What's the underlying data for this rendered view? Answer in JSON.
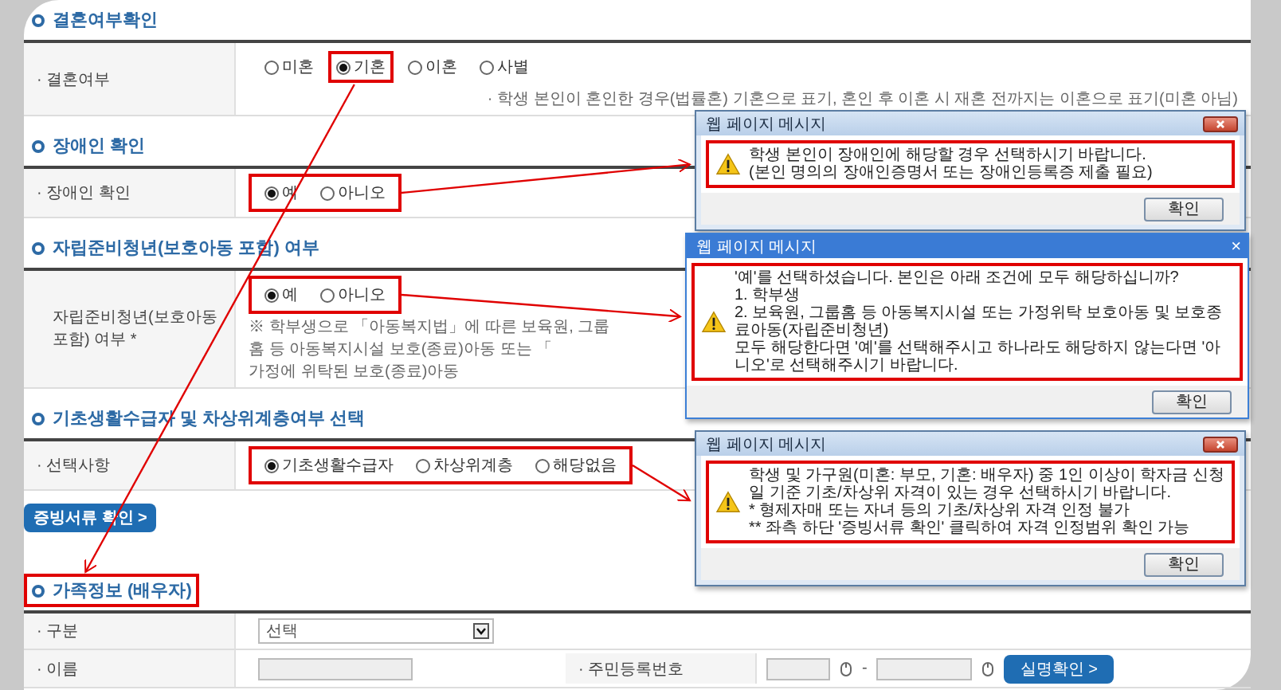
{
  "sections": [
    {
      "title": "결혼여부확인",
      "title_highlighted": false,
      "rows": [
        {
          "kind": "radio",
          "label": "· 결혼여부",
          "highlighted": false,
          "options": [
            {
              "label": "미혼",
              "selected": false,
              "highlighted": false
            },
            {
              "label": "기혼",
              "selected": true,
              "highlighted": true
            },
            {
              "label": "이혼",
              "selected": false,
              "highlighted": false
            },
            {
              "label": "사별",
              "selected": false,
              "highlighted": false
            }
          ],
          "note": "· 학생 본인이 혼인한 경우(법률혼) 기혼으로 표기, 혼인 후 이혼 시 재혼 전까지는 이혼으로 표기(미혼 아님)"
        }
      ]
    },
    {
      "title": "장애인 확인",
      "title_highlighted": false,
      "rows": [
        {
          "kind": "radio",
          "label": "· 장애인 확인",
          "highlighted": true,
          "options": [
            {
              "label": "예",
              "selected": true,
              "highlighted": false
            },
            {
              "label": "아니오",
              "selected": false,
              "highlighted": false
            }
          ],
          "dialog": {
            "kind": "classic",
            "title": "웹 페이지 메시지",
            "message_highlighted": true,
            "lines": [
              "학생 본인이 장애인에 해당할 경우 선택하시기 바랍니다.",
              "(본인 명의의 장애인증명서 또는 장애인등록증 제출 필요)"
            ],
            "button": "확인"
          }
        }
      ]
    },
    {
      "title": "자립준비청년(보호아동 포함) 여부",
      "title_highlighted": false,
      "rows": [
        {
          "kind": "radio",
          "label": "자립준비청년(보호아동 포함) 여부 *",
          "highlighted": true,
          "options": [
            {
              "label": "예",
              "selected": true,
              "highlighted": false
            },
            {
              "label": "아니오",
              "selected": false,
              "highlighted": false
            }
          ],
          "note": "※ 학부생으로 「아동복지법」에 따른 보육원, 그룹홈 등 아동복지시설 보호(종료)아동 또는 「",
          "note_end": "가정에 위탁된 보호(종료)아동",
          "dialog": {
            "kind": "flat",
            "title": "웹 페이지 메시지",
            "close": "×",
            "message_highlighted": true,
            "lines": [
              "'예'를 선택하셨습니다. 본인은 아래 조건에 모두 해당하십니까?",
              "1. 학부생",
              "2. 보육원, 그룹홈 등 아동복지시설 또는 가정위탁 보호아동 및 보호종료아동(자립준비청년)",
              "모두 해당한다면 '예'를 선택해주시고 하나라도 해당하지 않는다면 '아니오'로 선택해주시기 바랍니다."
            ],
            "button": "확인"
          }
        }
      ]
    },
    {
      "title": "기초생활수급자 및 차상위계층여부 선택",
      "title_highlighted": false,
      "rows": [
        {
          "kind": "radio",
          "label": "· 선택사항",
          "highlighted": true,
          "options": [
            {
              "label": "기초생활수급자",
              "selected": true,
              "highlighted": false
            },
            {
              "label": "차상위계층",
              "selected": false,
              "highlighted": false
            },
            {
              "label": "해당없음",
              "selected": false,
              "highlighted": false
            }
          ],
          "dialog": {
            "kind": "classic",
            "title": "웹 페이지 메시지",
            "message_highlighted": true,
            "lines": [
              "학생 및 가구원(미혼: 부모, 기혼: 배우자) 중 1인 이상이 학자금 신청일 기준 기초/차상위 자격이 있는 경우 선택하시기 바랍니다.",
              "* 형제자매 또는 자녀 등의 기초/차상위 자격 인정 불가",
              "** 좌측 하단 '증빙서류 확인' 클릭하여 자격 인정범위 확인 가능"
            ],
            "button": "확인"
          }
        }
      ],
      "button": "증빙서류 확인 >"
    },
    {
      "title": "가족정보 (배우자)",
      "title_highlighted": true,
      "rows": [
        {
          "kind": "select",
          "label": "· 구분",
          "value": "선택"
        },
        {
          "kind": "name",
          "label": "· 이름",
          "label_2": "· 주민등록번호",
          "separator": "-",
          "button": "실명확인 >"
        }
      ]
    }
  ]
}
